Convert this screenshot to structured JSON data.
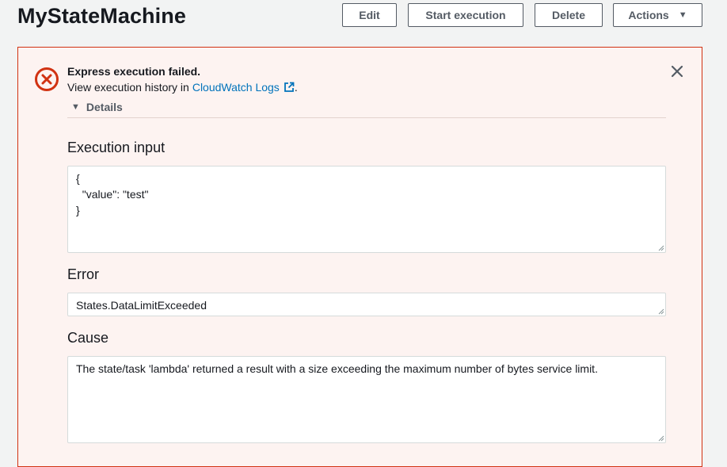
{
  "header": {
    "title": "MyStateMachine",
    "buttons": {
      "edit": "Edit",
      "start_execution": "Start execution",
      "delete": "Delete",
      "actions": "Actions"
    }
  },
  "alert": {
    "title": "Express execution failed.",
    "message_prefix": "View execution history in",
    "link_label": "CloudWatch Logs",
    "message_suffix": ".",
    "details_label": "Details"
  },
  "sections": {
    "execution_input": {
      "label": "Execution input",
      "value": "{\n  \"value\": \"test\"\n}"
    },
    "error": {
      "label": "Error",
      "value": "States.DataLimitExceeded"
    },
    "cause": {
      "label": "Cause",
      "value": "The state/task 'lambda' returned a result with a size exceeding the maximum number of bytes service limit."
    }
  },
  "colors": {
    "error_red": "#d13212",
    "alert_bg": "#fdf3f1",
    "link_blue": "#0073bb",
    "page_bg": "#f2f3f3"
  },
  "icons": {
    "alert": "error-circle-x-icon",
    "close": "close-icon",
    "external_link": "external-link-icon",
    "details_toggle": "caret-down-icon",
    "actions_caret": "caret-down-icon"
  }
}
